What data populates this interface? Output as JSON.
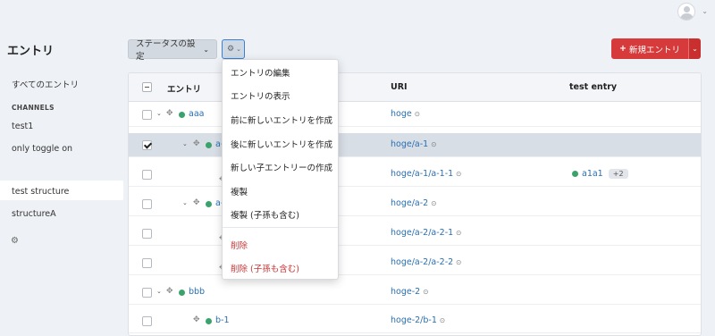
{
  "header": {
    "avatar_caret": "⌄"
  },
  "sidebar": {
    "title": "エントリ",
    "all_entries": "すべてのエントリ",
    "channels_heading": "CHANNELS",
    "channels": [
      "test1",
      "only toggle on"
    ],
    "structures": [
      "test structure",
      "structureA"
    ]
  },
  "toolbar": {
    "status_label": "ステータスの設定",
    "status_caret": "⌄",
    "gear_icon": "⚙",
    "gear_caret": "⌄",
    "new_entry_label": "新規エントリ",
    "new_entry_plus": "+",
    "new_entry_caret": "⌄"
  },
  "table": {
    "headers": {
      "entry": "エントリ",
      "uri": "URI",
      "test_entry": "test entry"
    },
    "rows": [
      {
        "title": "aaa",
        "uri": "hoge",
        "selected": false
      },
      {
        "title": "a-",
        "uri": "hoge/a-1",
        "selected": true
      },
      {
        "title": "",
        "uri": "hoge/a-1/a-1-1",
        "selected": false,
        "test_entry": "a1a1",
        "badge": "+2"
      },
      {
        "title": "a-",
        "uri": "hoge/a-2",
        "selected": false
      },
      {
        "title": "",
        "uri": "hoge/a-2/a-2-1",
        "selected": false
      },
      {
        "title": "",
        "uri": "hoge/a-2/a-2-2",
        "selected": false
      },
      {
        "title": "bbb",
        "uri": "hoge-2",
        "selected": false
      },
      {
        "title": "b-1",
        "uri": "hoge-2/b-1",
        "selected": false
      }
    ],
    "toggle_icon": "⌄",
    "move_icon": "✥",
    "link_icon": "⊙"
  },
  "menu": {
    "items": [
      "エントリの編集",
      "エントリの表示",
      "前に新しいエントリを作成",
      "後に新しいエントリを作成",
      "新しい子エントリーの作成",
      "複製",
      "複製 (子孫も含む)"
    ],
    "danger_items": [
      "削除",
      "削除 (子孫も含む)"
    ]
  },
  "colors": {
    "accent": "#d63a3a",
    "link": "#2a6fb0",
    "status_green": "#3aa36c",
    "danger_text": "#c83434"
  }
}
